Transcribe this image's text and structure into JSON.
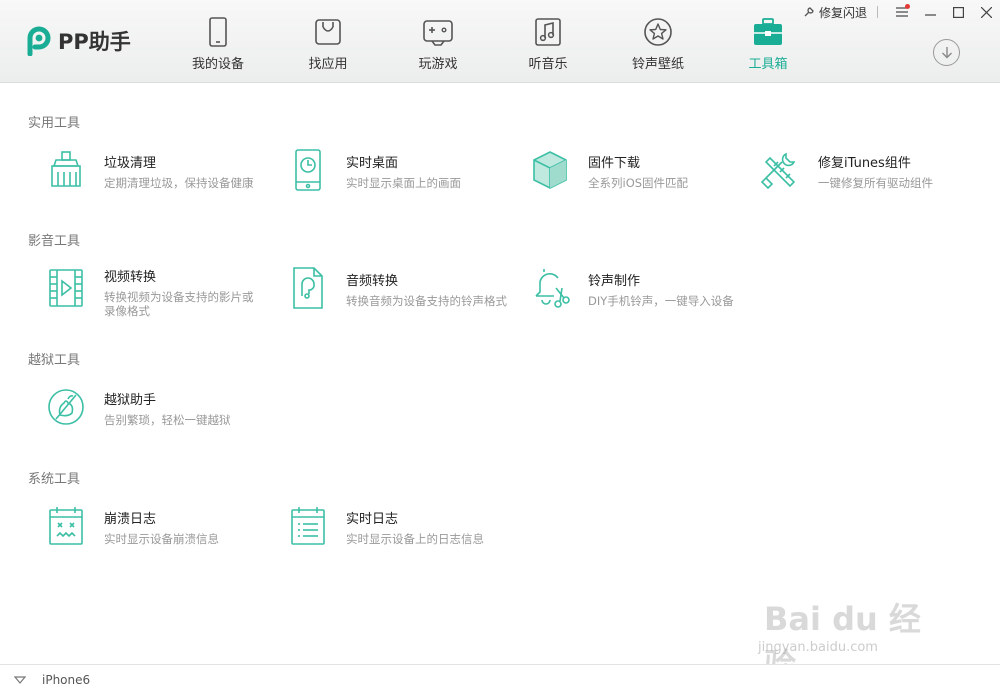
{
  "app": {
    "logo_text": "PP助手"
  },
  "nav": {
    "items": [
      {
        "label": "我的设备",
        "icon": "phone-icon"
      },
      {
        "label": "找应用",
        "icon": "bag-icon"
      },
      {
        "label": "玩游戏",
        "icon": "gamepad-icon"
      },
      {
        "label": "听音乐",
        "icon": "music-icon"
      },
      {
        "label": "铃声壁纸",
        "icon": "star-icon"
      },
      {
        "label": "工具箱",
        "icon": "toolbox-icon"
      }
    ],
    "active": "工具箱"
  },
  "titlebar": {
    "repair_label": "修复闪退"
  },
  "sections": [
    {
      "title": "实用工具",
      "tools": [
        {
          "name": "垃圾清理",
          "desc": "定期清理垃圾，保持设备健康",
          "icon": "broom-icon"
        },
        {
          "name": "实时桌面",
          "desc": "实时显示桌面上的画面",
          "icon": "phone-clock-icon"
        },
        {
          "name": "固件下载",
          "desc": "全系列iOS固件匹配",
          "icon": "cube-icon"
        },
        {
          "name": "修复iTunes组件",
          "desc": "一键修复所有驱动组件",
          "icon": "wrench-icon"
        }
      ]
    },
    {
      "title": "影音工具",
      "tools": [
        {
          "name": "视频转换",
          "desc": "转换视频为设备支持的影片或录像格式",
          "desc_line1": "转换视频为设备支持的影片或",
          "desc_line2": "录像格式",
          "icon": "video-file-icon"
        },
        {
          "name": "音频转换",
          "desc": "转换音频为设备支持的铃声格式",
          "icon": "audio-file-icon"
        },
        {
          "name": "铃声制作",
          "desc": "DIY手机铃声，一键导入设备",
          "icon": "bell-scissors-icon"
        }
      ]
    },
    {
      "title": "越狱工具",
      "tools": [
        {
          "name": "越狱助手",
          "desc": "告别繁琐，轻松一键越狱",
          "icon": "jailbreak-icon"
        }
      ]
    },
    {
      "title": "系统工具",
      "tools": [
        {
          "name": "崩溃日志",
          "desc": "实时显示设备崩溃信息",
          "icon": "crash-log-icon"
        },
        {
          "name": "实时日志",
          "desc": "实时显示设备上的日志信息",
          "icon": "live-log-icon"
        }
      ]
    }
  ],
  "footer": {
    "device_name": "iPhone6"
  },
  "watermark": {
    "main": "Bai du 经验",
    "sub": "jingyan.baidu.com"
  },
  "colors": {
    "accent": "#1aad95",
    "icon_green": "#3cbfa5"
  }
}
